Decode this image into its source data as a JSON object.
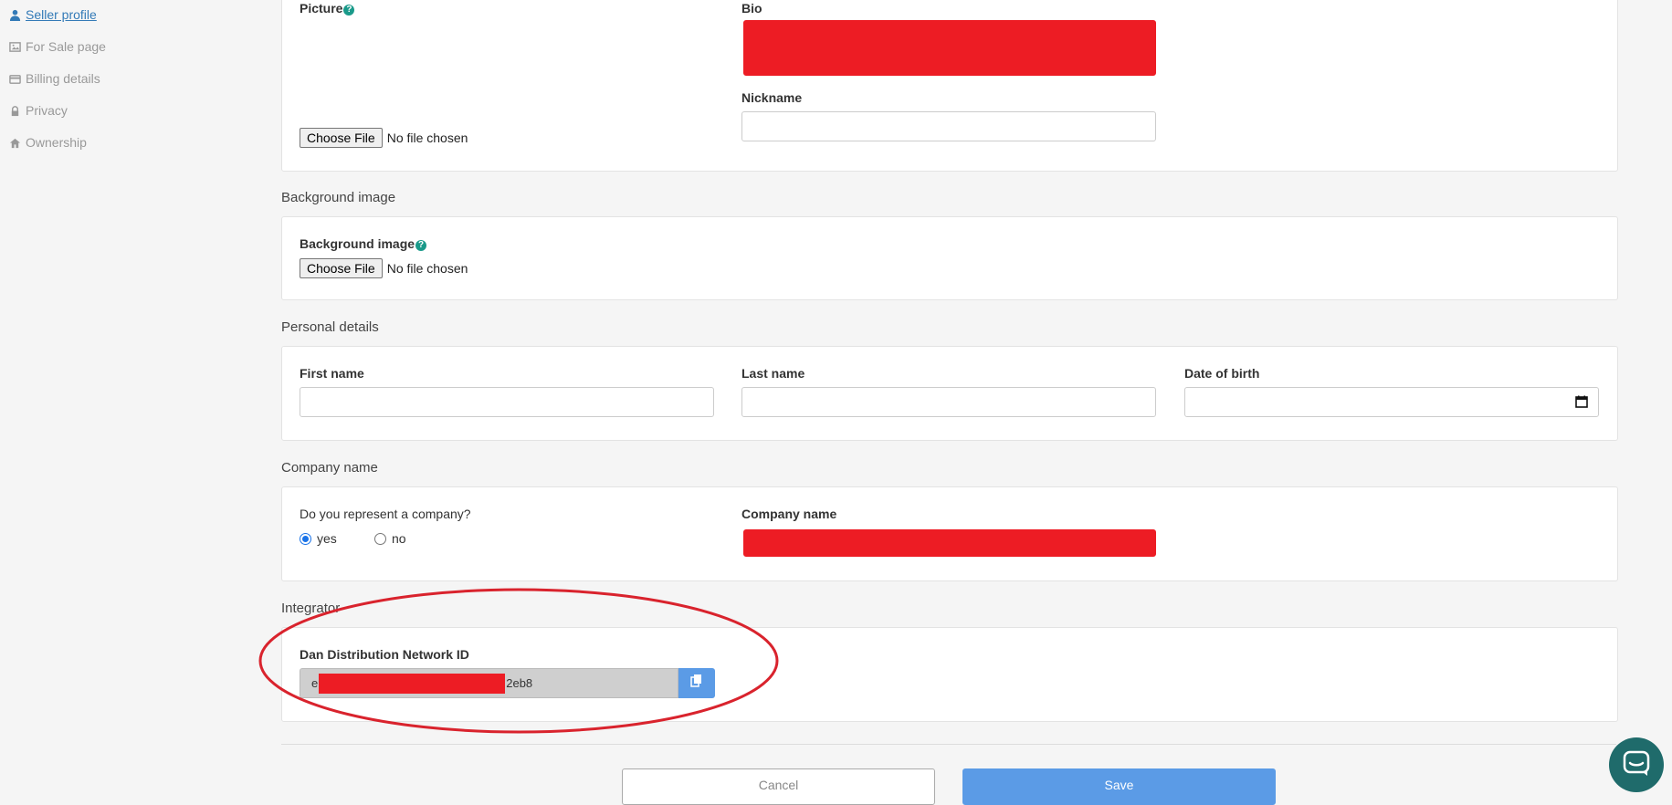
{
  "sidebar": {
    "items": [
      {
        "label": "Seller profile",
        "icon": "user-icon",
        "active": true
      },
      {
        "label": "For Sale page",
        "icon": "picture-icon"
      },
      {
        "label": "Billing details",
        "icon": "credit-card-icon"
      },
      {
        "label": "Privacy",
        "icon": "lock-icon"
      },
      {
        "label": "Ownership",
        "icon": "home-icon"
      }
    ]
  },
  "profile": {
    "picture_label": "Picture",
    "bio_label": "Bio",
    "nickname_label": "Nickname",
    "nickname_value": "",
    "file_button": "Choose File",
    "file_status": "No file chosen"
  },
  "background": {
    "section_title": "Background image",
    "label": "Background image",
    "file_button": "Choose File",
    "file_status": "No file chosen"
  },
  "personal": {
    "section_title": "Personal details",
    "first_name_label": "First name",
    "last_name_label": "Last name",
    "dob_label": "Date of birth"
  },
  "company": {
    "section_title": "Company name",
    "question": "Do you represent a company?",
    "yes_label": "yes",
    "no_label": "no",
    "selected": "yes",
    "company_name_label": "Company name"
  },
  "integrator": {
    "section_title": "Integrator",
    "id_label": "Dan Distribution Network ID",
    "id_prefix": "e",
    "id_suffix": "2eb8"
  },
  "actions": {
    "cancel_label": "Cancel",
    "save_label": "Save"
  },
  "colors": {
    "accent": "#5b9be6",
    "redaction": "#ed1c24",
    "annotation": "#d9232d",
    "chat": "#1f6b6b"
  }
}
